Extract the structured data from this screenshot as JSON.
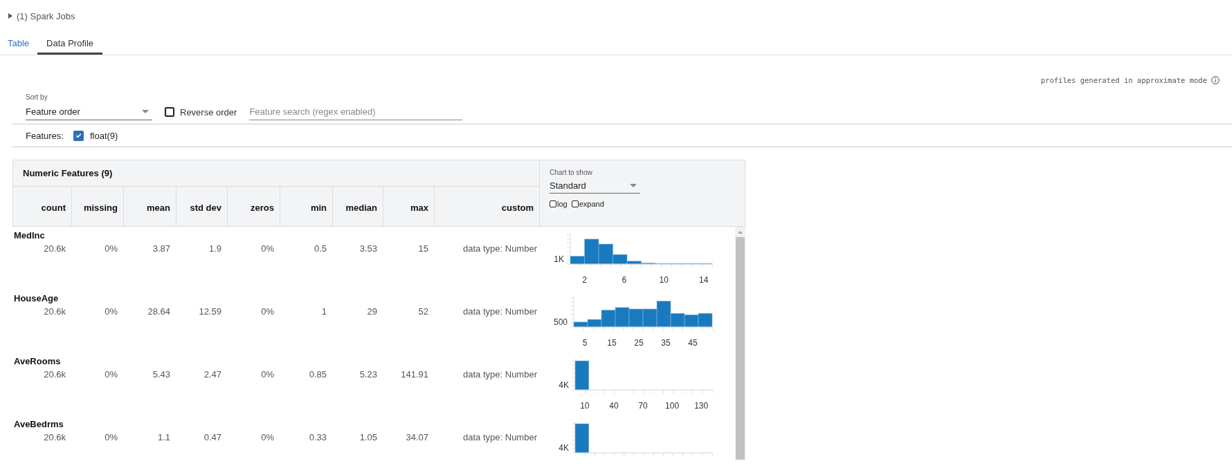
{
  "spark_jobs": {
    "label": "(1) Spark Jobs",
    "expanded": false
  },
  "tabs": [
    {
      "label": "Table",
      "selected": false
    },
    {
      "label": "Data Profile",
      "selected": true
    }
  ],
  "approx_note": "profiles generated in approximate mode",
  "sort_by": {
    "label": "Sort by",
    "value": "Feature order"
  },
  "reverse_order": {
    "label": "Reverse order",
    "checked": false
  },
  "search": {
    "placeholder": "Feature search (regex enabled)"
  },
  "features_filter": {
    "label": "Features:",
    "options": [
      {
        "label": "float(9)",
        "checked": true
      }
    ]
  },
  "numeric_table": {
    "title": "Numeric Features (9)",
    "columns": [
      "count",
      "missing",
      "mean",
      "std dev",
      "zeros",
      "min",
      "median",
      "max",
      "custom"
    ],
    "chart_to_show": {
      "label": "Chart to show",
      "value": "Standard"
    },
    "log": {
      "label": "log",
      "checked": false
    },
    "expand": {
      "label": "expand",
      "checked": false
    },
    "rows": [
      {
        "name": "MedInc",
        "cells": [
          "20.6k",
          "0%",
          "3.87",
          "1.9",
          "0%",
          "0.5",
          "3.53",
          "15",
          "data type: Number"
        ],
        "histogram": {
          "y_label": "1K",
          "x_labels": [
            "2",
            "6",
            "10",
            "14"
          ]
        }
      },
      {
        "name": "HouseAge",
        "cells": [
          "20.6k",
          "0%",
          "28.64",
          "12.59",
          "0%",
          "1",
          "29",
          "52",
          "data type: Number"
        ],
        "histogram": {
          "y_label": "500",
          "x_labels": [
            "5",
            "15",
            "25",
            "35",
            "45"
          ]
        }
      },
      {
        "name": "AveRooms",
        "cells": [
          "20.6k",
          "0%",
          "5.43",
          "2.47",
          "0%",
          "0.85",
          "5.23",
          "141.91",
          "data type: Number"
        ],
        "histogram": {
          "y_label": "4K",
          "x_labels": [
            "10",
            "40",
            "70",
            "100",
            "130"
          ]
        }
      },
      {
        "name": "AveBedrms",
        "cells": [
          "20.6k",
          "0%",
          "1.1",
          "0.47",
          "0%",
          "0.33",
          "1.05",
          "34.07",
          "data type: Number"
        ],
        "histogram": {
          "y_label": "4K"
        }
      }
    ]
  }
}
